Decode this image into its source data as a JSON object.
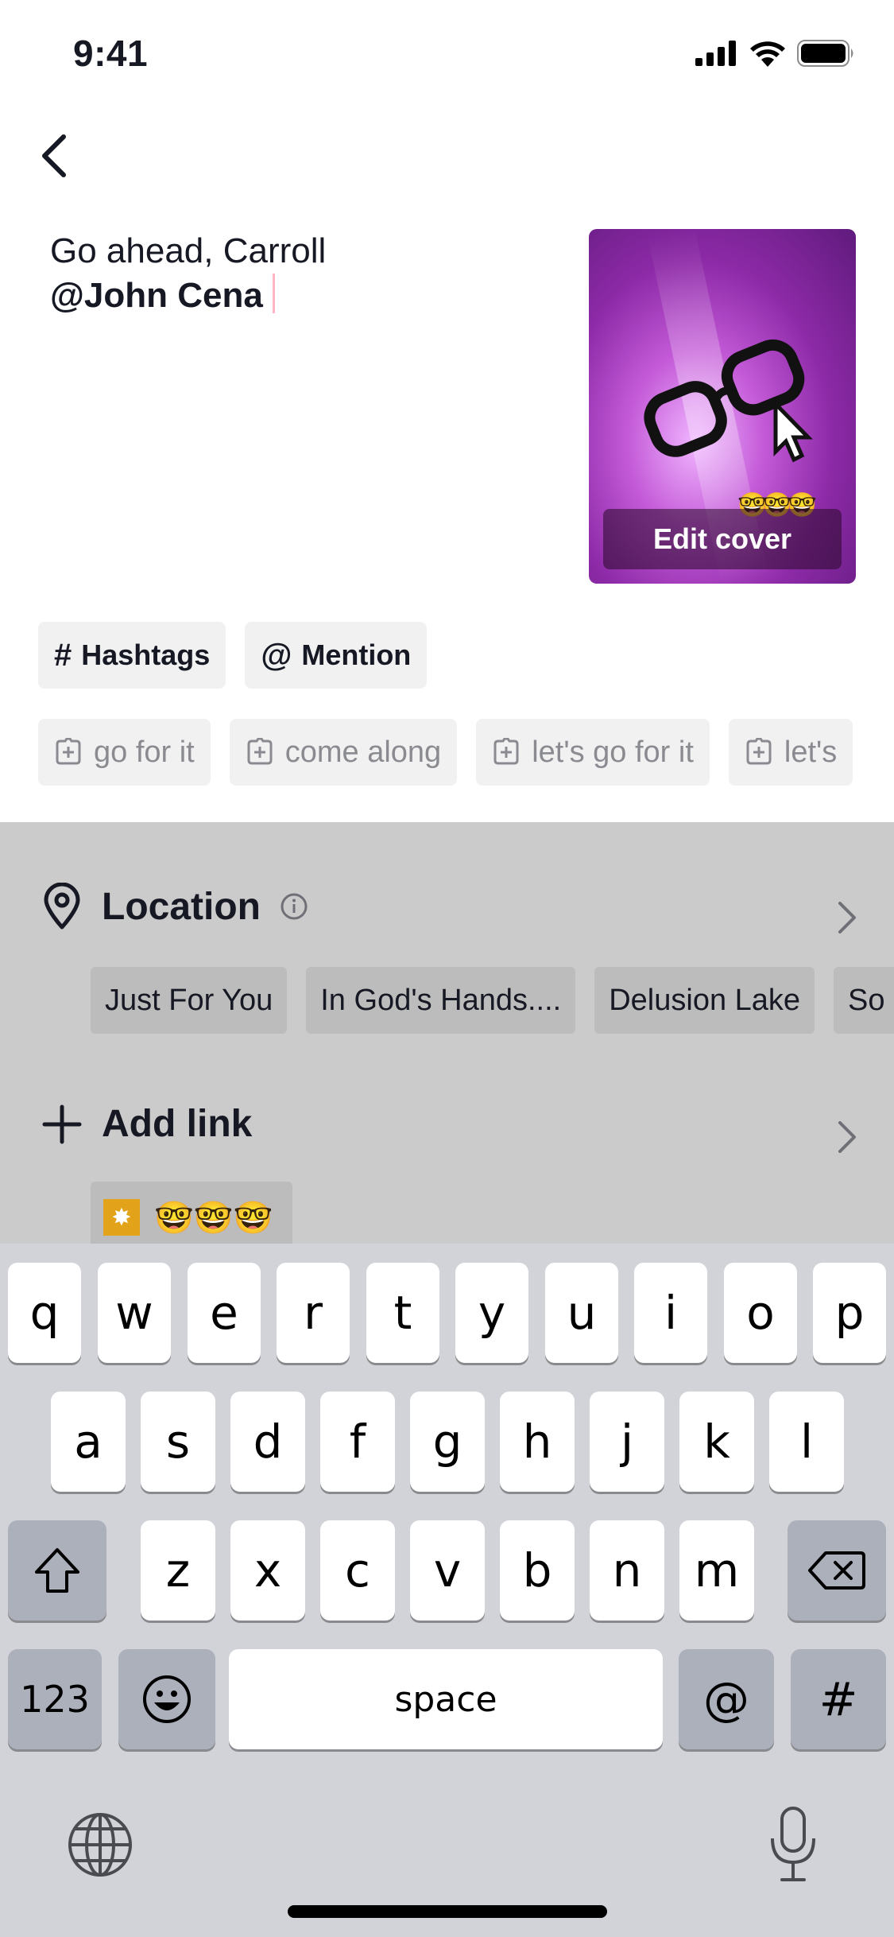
{
  "status_bar": {
    "time": "9:41"
  },
  "caption": {
    "line1": "Go ahead, Carroll",
    "line2": "@John Cena"
  },
  "cover": {
    "edit_label": "Edit cover",
    "emoji": "🤓🤓🤓"
  },
  "tools": [
    {
      "symbol": "#",
      "label": "Hashtags"
    },
    {
      "symbol": "@",
      "label": "Mention"
    }
  ],
  "suggestions": [
    "go for it",
    "come along",
    "let's go for it",
    "let's"
  ],
  "location": {
    "label": "Location",
    "chips": [
      "Just For You",
      "In God's Hands....",
      "Delusion Lake",
      "So"
    ]
  },
  "add_link": {
    "label": "Add link",
    "chip_emoji": "🤓🤓🤓"
  },
  "keyboard": {
    "row1": [
      "q",
      "w",
      "e",
      "r",
      "t",
      "y",
      "u",
      "i",
      "o",
      "p"
    ],
    "row2": [
      "a",
      "s",
      "d",
      "f",
      "g",
      "h",
      "j",
      "k",
      "l"
    ],
    "row3": [
      "z",
      "x",
      "c",
      "v",
      "b",
      "n",
      "m"
    ],
    "numbers_label": "123",
    "space_label": "space",
    "at_label": "@",
    "hash_label": "#"
  },
  "colors": {
    "accent": "#fe2c55",
    "keyboard_bg": "#d1d3d9",
    "dim_bg": "#cbcbcb"
  }
}
